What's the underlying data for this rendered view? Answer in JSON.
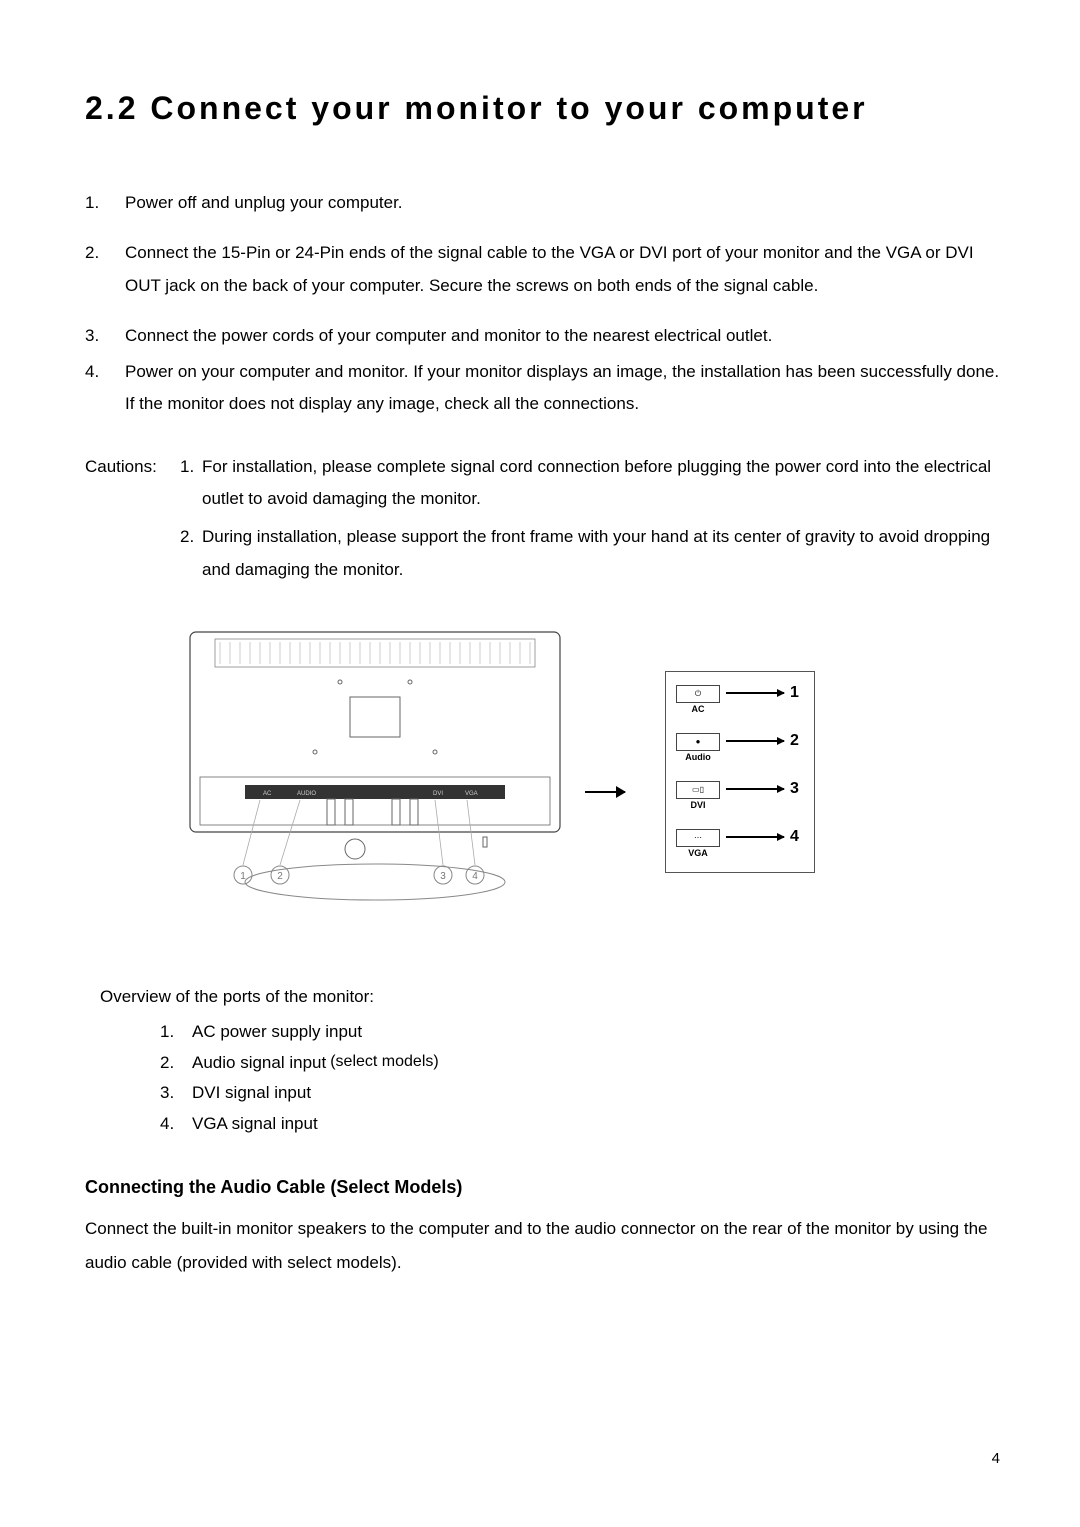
{
  "heading": "2.2  Connect your monitor to your computer",
  "steps": [
    {
      "n": "1.",
      "text": "Power off and unplug your computer."
    },
    {
      "n": "2.",
      "text": "Connect the 15-Pin or 24-Pin ends of the signal cable to the VGA or DVI port of your monitor and the VGA or DVI OUT jack on the back of your computer. Secure the screws on both ends of the signal cable."
    },
    {
      "n": "3.",
      "text": "Connect the power cords of your computer and monitor to the nearest electrical outlet."
    },
    {
      "n": "4.",
      "text": "Power on your computer and monitor. If your monitor displays an image, the installation has been successfully done. If the monitor does not display any image, check all the connections."
    }
  ],
  "cautions_label": "Cautions:",
  "cautions": [
    {
      "n": "1.",
      "text": "For installation, please complete signal cord connection before plugging the power cord into the electrical outlet to avoid damaging the monitor."
    },
    {
      "n": "2.",
      "text": "During installation, please support the front frame with your hand at its center of gravity to avoid dropping and damaging the monitor."
    }
  ],
  "legend": [
    {
      "label": "AC",
      "num": "1"
    },
    {
      "label": "Audio",
      "num": "2"
    },
    {
      "label": "DVI",
      "num": "3"
    },
    {
      "label": "VGA",
      "num": "4"
    }
  ],
  "diagram_callouts": [
    "1",
    "2",
    "3",
    "4"
  ],
  "overview_title": "Overview of the ports of the monitor:",
  "overview": [
    {
      "n": "1.",
      "text": "AC power supply input",
      "note": ""
    },
    {
      "n": "2.",
      "text": "Audio signal input",
      "note": "(select models)"
    },
    {
      "n": "3.",
      "text": "DVI signal input",
      "note": ""
    },
    {
      "n": "4.",
      "text": "VGA signal input",
      "note": ""
    }
  ],
  "sub_heading_main": "Connecting the Audio Cable",
  "sub_heading_paren": "(Select Models)",
  "body": "Connect the built-in monitor speakers to the computer and to the audio connector on the rear of the monitor by using the audio cable (provided with select models).",
  "page_number": "4"
}
